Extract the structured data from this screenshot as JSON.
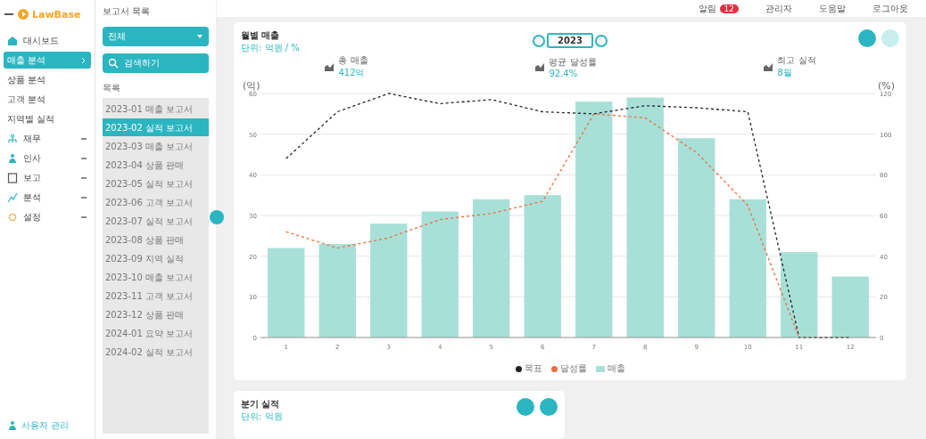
{
  "logo": {
    "text": "LawBase"
  },
  "sidebar": {
    "items": [
      {
        "label": "대시보드",
        "kind": "home",
        "selected": false
      },
      {
        "label": "매출 분석",
        "kind": "link",
        "selected": true
      },
      {
        "label": "상품 분석",
        "kind": "link",
        "selected": false
      },
      {
        "label": "고객 분석",
        "kind": "link",
        "selected": false
      },
      {
        "label": "지역별 실적",
        "kind": "link",
        "selected": false
      },
      {
        "label": "재무",
        "kind": "group",
        "selected": false
      },
      {
        "label": "인사",
        "kind": "group",
        "selected": false
      },
      {
        "label": "보고",
        "kind": "group",
        "selected": false
      },
      {
        "label": "분석",
        "kind": "group",
        "selected": false
      },
      {
        "label": "설정",
        "kind": "group",
        "selected": false
      }
    ],
    "footer": "사용자 관리"
  },
  "reports": {
    "title": "보고서 목록",
    "filter": "전체",
    "search": "검색하기",
    "list_label": "목록",
    "items": [
      {
        "label": "2023-01 매출 보고서",
        "selected": false
      },
      {
        "label": "2023-02 실적 보고서",
        "selected": true
      },
      {
        "label": "2023-03 매출 보고서",
        "selected": false
      },
      {
        "label": "2023-04 상품 판매",
        "selected": false
      },
      {
        "label": "2023-05 실적 보고서",
        "selected": false
      },
      {
        "label": "2023-06 고객 보고서",
        "selected": false
      },
      {
        "label": "2023-07 실적 보고서",
        "selected": false
      },
      {
        "label": "2023-08 상품 판매",
        "selected": false
      },
      {
        "label": "2023-09 지역 실적",
        "selected": false
      },
      {
        "label": "2023-10 매출 보고서",
        "selected": false
      },
      {
        "label": "2023-11 고객 보고서",
        "selected": false
      },
      {
        "label": "2023-12 상품 판매",
        "selected": false
      },
      {
        "label": "2024-01 요약 보고서",
        "selected": false
      },
      {
        "label": "2024-02 실적 보고서",
        "selected": false
      }
    ]
  },
  "header": {
    "notifications": "알림",
    "badge": "12",
    "user": "관리자",
    "help": "도움말",
    "logout": "로그아웃"
  },
  "chart_card": {
    "title": "월별 매출",
    "subtitle": "단위: 억원 / %",
    "period": "2023",
    "stats": [
      {
        "label": "총 매출",
        "value": "412억"
      },
      {
        "label": "평균 달성률",
        "value": "92.4%"
      },
      {
        "label": "최고 실적",
        "value": "8월"
      }
    ],
    "axis_left": "(억)",
    "axis_right": "(%)",
    "chart_data": {
      "type": "bar",
      "categories": [
        "1",
        "2",
        "3",
        "4",
        "5",
        "6",
        "7",
        "8",
        "9",
        "10",
        "11",
        "12"
      ],
      "grid": true,
      "ylim": [
        0,
        60
      ],
      "yticks": [
        0,
        10,
        20,
        30,
        40,
        50,
        60
      ],
      "y2lim": [
        0,
        120
      ],
      "y2ticks": [
        0,
        20,
        40,
        60,
        80,
        100,
        120
      ],
      "series": [
        {
          "name": "목표",
          "color": "#222222",
          "type": "line",
          "line_style": "dashed",
          "axis": "y2",
          "values": [
            88,
            111,
            120,
            115,
            117,
            111,
            110,
            114,
            113,
            111,
            0,
            0
          ]
        },
        {
          "name": "달성률",
          "color": "#f26b3a",
          "type": "line",
          "line_style": "dashed",
          "axis": "y2",
          "values": [
            52,
            44,
            49,
            58,
            61,
            67,
            110,
            108,
            91,
            65,
            0,
            null
          ]
        },
        {
          "name": "매출",
          "color": "#a8e0d8",
          "type": "bar",
          "values": [
            22,
            23,
            28,
            31,
            34,
            35,
            58,
            59,
            49,
            34,
            21,
            15
          ]
        }
      ]
    }
  },
  "second_card": {
    "title": "분기 실적",
    "subtitle": "단위: 억원"
  }
}
